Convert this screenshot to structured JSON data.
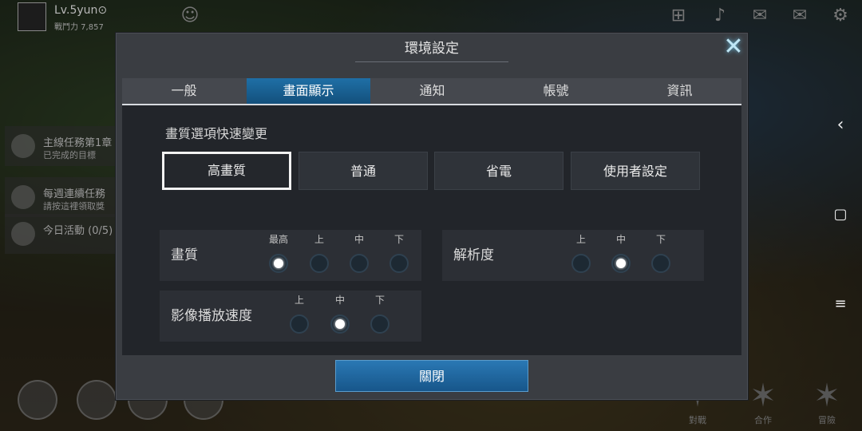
{
  "hud": {
    "player_level": "Lv.5yun⊙",
    "player_power": "戰鬥力 7,857",
    "quests": [
      {
        "title": "主線任務第1章",
        "sub": "已完成的目標"
      },
      {
        "title": "每週連續任務",
        "sub": "請按這裡領取獎"
      },
      {
        "title": "今日活動 (0/5)",
        "sub": ""
      }
    ],
    "right_actions": [
      "對戰",
      "合作",
      "冒險"
    ],
    "icons": {
      "gamepad": "gamepad-icon",
      "bell": "bell-icon",
      "chat": "chat-icon",
      "mail": "mail-icon",
      "gear": "gear-icon"
    }
  },
  "dialog": {
    "title": "環境設定",
    "close_icon": "close-icon",
    "tabs": [
      {
        "label": "一般",
        "active": false
      },
      {
        "label": "畫面顯示",
        "active": true
      },
      {
        "label": "通知",
        "active": false
      },
      {
        "label": "帳號",
        "active": false
      },
      {
        "label": "資訊",
        "active": false
      }
    ],
    "quick_title": "畫質選項快速變更",
    "presets": [
      {
        "label": "高畫質",
        "selected": true
      },
      {
        "label": "普通",
        "selected": false
      },
      {
        "label": "省電",
        "selected": false
      },
      {
        "label": "使用者設定",
        "selected": false
      }
    ],
    "quality": {
      "label": "畫質",
      "options": [
        "最高",
        "上",
        "中",
        "下"
      ],
      "selected": "最高"
    },
    "resolution": {
      "label": "解析度",
      "options": [
        "上",
        "中",
        "下"
      ],
      "selected": "中"
    },
    "playback": {
      "label": "影像播放速度",
      "options": [
        "上",
        "中",
        "下"
      ],
      "selected": "中"
    },
    "close_label": "關閉"
  },
  "colors": {
    "accent_tab": "#1f6fa6",
    "radio_selected": "#ffffff",
    "close_icon": "#bfe6f5"
  }
}
